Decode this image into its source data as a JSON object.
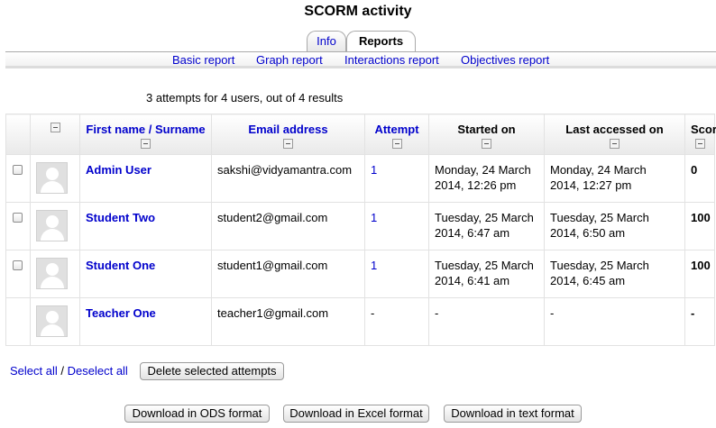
{
  "page": {
    "title": "SCORM activity"
  },
  "tabs": [
    {
      "label": "Info",
      "active": false
    },
    {
      "label": "Reports",
      "active": true
    }
  ],
  "subnav": [
    "Basic report",
    "Graph report",
    "Interactions report",
    "Objectives report"
  ],
  "summary": "3 attempts for 4 users, out of 4 results",
  "table": {
    "headers": {
      "name": "First name / Surname",
      "email": "Email address",
      "attempt": "Attempt",
      "started": "Started on",
      "last": "Last accessed on",
      "score": "Score"
    },
    "rows": [
      {
        "name": "Admin User",
        "email": "sakshi@vidyamantra.com",
        "attempt": "1",
        "started": [
          "Monday, 24 March",
          "2014, 12:26 pm"
        ],
        "last": [
          "Monday, 24 March",
          "2014, 12:27 pm"
        ],
        "score": "0",
        "has_checkbox": true
      },
      {
        "name": "Student Two",
        "email": "student2@gmail.com",
        "attempt": "1",
        "started": [
          "Tuesday, 25 March",
          "2014, 6:47 am"
        ],
        "last": [
          "Tuesday, 25 March",
          "2014, 6:50 am"
        ],
        "score": "100",
        "has_checkbox": true
      },
      {
        "name": "Student One",
        "email": "student1@gmail.com",
        "attempt": "1",
        "started": [
          "Tuesday, 25 March",
          "2014, 6:41 am"
        ],
        "last": [
          "Tuesday, 25 March",
          "2014, 6:45 am"
        ],
        "score": "100",
        "has_checkbox": true
      },
      {
        "name": "Teacher One",
        "email": "teacher1@gmail.com",
        "attempt": "-",
        "started": [
          "-",
          ""
        ],
        "last": [
          "-",
          ""
        ],
        "score": "-",
        "has_checkbox": false
      }
    ]
  },
  "controls": {
    "select_all": "Select all",
    "separator": "/",
    "deselect_all": "Deselect all",
    "delete_button": "Delete selected attempts",
    "download_ods": "Download in ODS format",
    "download_excel": "Download in Excel format",
    "download_text": "Download in text format"
  },
  "colors": {
    "link": "#0000cc",
    "border": "#e2e2e2"
  }
}
